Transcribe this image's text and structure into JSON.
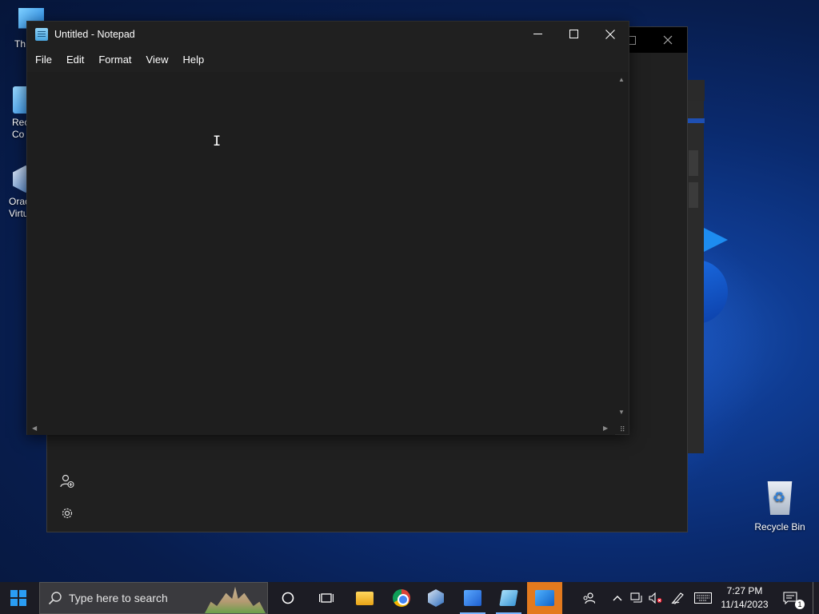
{
  "desktop": {
    "icons": [
      {
        "label": "Th",
        "glyph": "this-pc-icon"
      },
      {
        "label": "Rec\nCo",
        "glyph": "remote-desktop-icon"
      },
      {
        "label": "Orac\nVirtu",
        "glyph": "virtualbox-icon"
      }
    ],
    "recycle_bin_label": "Recycle Bin"
  },
  "notepad": {
    "title": "Untitled - Notepad",
    "menu": [
      "File",
      "Edit",
      "Format",
      "View",
      "Help"
    ],
    "content": ""
  },
  "taskbar": {
    "search_placeholder": "Type here to search",
    "time": "7:27 PM",
    "date": "11/14/2023",
    "notification_count": "1",
    "accent_color": "#2a9df4"
  }
}
